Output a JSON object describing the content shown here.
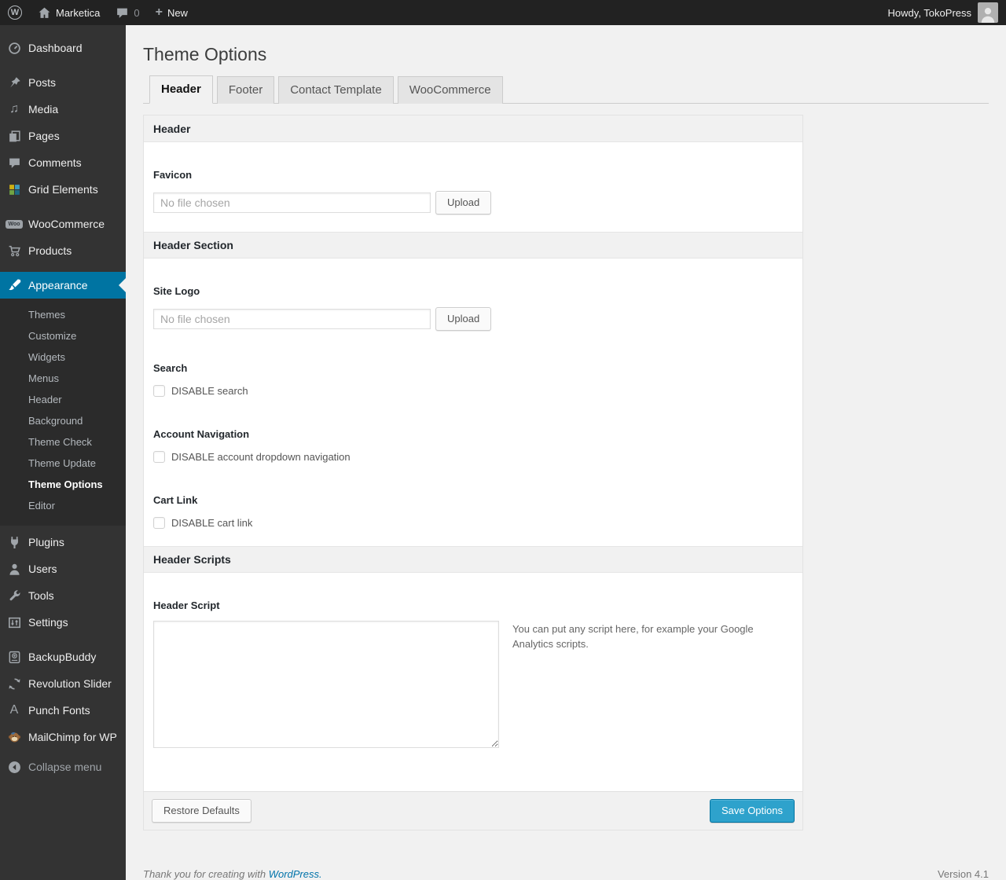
{
  "admin_bar": {
    "logo_letter": "W",
    "site_name": "Marketica",
    "comment_count": "0",
    "plus": "+",
    "new_label": "New",
    "howdy": "Howdy, TokoPress"
  },
  "sidebar": {
    "items": [
      {
        "label": "Dashboard"
      },
      {
        "label": "Posts"
      },
      {
        "label": "Media"
      },
      {
        "label": "Pages"
      },
      {
        "label": "Comments"
      },
      {
        "label": "Grid Elements"
      },
      {
        "label": "WooCommerce"
      },
      {
        "label": "Products"
      },
      {
        "label": "Appearance"
      },
      {
        "label": "Plugins"
      },
      {
        "label": "Users"
      },
      {
        "label": "Tools"
      },
      {
        "label": "Settings"
      },
      {
        "label": "BackupBuddy"
      },
      {
        "label": "Revolution Slider"
      },
      {
        "label": "Punch Fonts"
      },
      {
        "label": "MailChimp for WP"
      }
    ],
    "submenu": [
      {
        "label": "Themes"
      },
      {
        "label": "Customize"
      },
      {
        "label": "Widgets"
      },
      {
        "label": "Menus"
      },
      {
        "label": "Header"
      },
      {
        "label": "Background"
      },
      {
        "label": "Theme Check"
      },
      {
        "label": "Theme Update"
      },
      {
        "label": "Theme Options",
        "active": true
      },
      {
        "label": "Editor"
      }
    ],
    "collapse_label": "Collapse menu"
  },
  "icons": {
    "media": "♫",
    "woo_badge": "Woo",
    "punch_fonts_letter": "A"
  },
  "page": {
    "title": "Theme Options",
    "tabs": [
      {
        "label": "Header",
        "active": true
      },
      {
        "label": "Footer"
      },
      {
        "label": "Contact Template"
      },
      {
        "label": "WooCommerce"
      }
    ]
  },
  "panel": {
    "sections": {
      "header": "Header",
      "header_section": "Header Section",
      "header_scripts": "Header Scripts"
    },
    "favicon": {
      "label": "Favicon",
      "placeholder": "No file chosen",
      "upload": "Upload"
    },
    "site_logo": {
      "label": "Site Logo",
      "placeholder": "No file chosen",
      "upload": "Upload"
    },
    "search": {
      "label": "Search",
      "checkbox": "DISABLE search"
    },
    "account_navigation": {
      "label": "Account Navigation",
      "checkbox": "DISABLE account dropdown navigation"
    },
    "cart_link": {
      "label": "Cart Link",
      "checkbox": "DISABLE cart link"
    },
    "header_script": {
      "label": "Header Script",
      "help": "You can put any script here, for example your Google Analytics scripts."
    },
    "actions": {
      "restore": "Restore Defaults",
      "save": "Save Options"
    }
  },
  "footer": {
    "thanks": "Thank you for creating with",
    "link": "WordPress.",
    "version": "Version 4.1"
  },
  "colors": {
    "accent": "#0074a2",
    "button_primary": "#2ea2cc",
    "admin_bar_bg": "#222222",
    "sidebar_bg": "#333333",
    "page_bg": "#f1f1f1",
    "link": "#0073aa"
  }
}
